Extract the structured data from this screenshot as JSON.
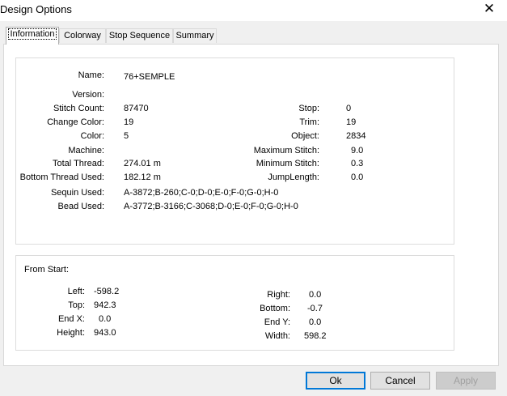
{
  "window": {
    "title": "Design Options",
    "close_glyph": "✕"
  },
  "tabs": [
    {
      "label": "Information"
    },
    {
      "label": "Colorway"
    },
    {
      "label": "Stop Sequence"
    },
    {
      "label": "Summary"
    }
  ],
  "info": {
    "name_label": "Name:",
    "name_value": "76+SEMPLE",
    "version_label": "Version:",
    "version_value": "",
    "stitch_count_label": "Stitch Count:",
    "stitch_count_value": "87470",
    "change_color_label": "Change Color:",
    "change_color_value": "19",
    "color_label": "Color:",
    "color_value": "5",
    "machine_label": "Machine:",
    "machine_value": "",
    "total_thread_label": "Total Thread:",
    "total_thread_value": "274.01 m",
    "bottom_thread_label": "Bottom Thread Used:",
    "bottom_thread_value": "182.12 m",
    "sequin_label": "Sequin Used:",
    "sequin_value": "A-3872;B-260;C-0;D-0;E-0;F-0;G-0;H-0",
    "bead_label": "Bead Used:",
    "bead_value": "A-3772;B-3166;C-3068;D-0;E-0;F-0;G-0;H-0",
    "stop_label": "Stop:",
    "stop_value": "0",
    "trim_label": "Trim:",
    "trim_value": "19",
    "object_label": "Object:",
    "object_value": "2834",
    "max_stitch_label": "Maximum Stitch:",
    "max_stitch_value": "9.0",
    "min_stitch_label": "Minimum Stitch:",
    "min_stitch_value": "0.3",
    "jump_length_label": "JumpLength:",
    "jump_length_value": "0.0"
  },
  "from_start": {
    "heading": "From Start:",
    "left_label": "Left:",
    "left_value": "-598.2",
    "top_label": "Top:",
    "top_value": "942.3",
    "endx_label": "End X:",
    "endx_value": "0.0",
    "height_label": "Height:",
    "height_value": "943.0",
    "right_label": "Right:",
    "right_value": "0.0",
    "bottom_label": "Bottom:",
    "bottom_value": "-0.7",
    "endy_label": "End Y:",
    "endy_value": "0.0",
    "width_label": "Width:",
    "width_value": "598.2"
  },
  "buttons": {
    "ok": "Ok",
    "cancel": "Cancel",
    "apply": "Apply"
  }
}
